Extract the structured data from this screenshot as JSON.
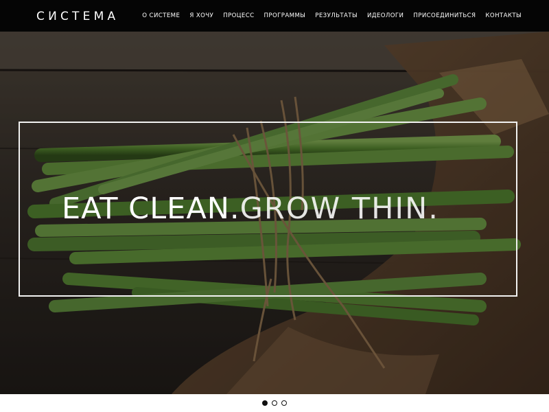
{
  "header": {
    "logo": "СИСТЕМА",
    "nav": [
      {
        "label": "О СИСТЕМЕ",
        "id": "about"
      },
      {
        "label": "Я ХОЧУ",
        "id": "i-want"
      },
      {
        "label": "ПРОЦЕСС",
        "id": "process"
      },
      {
        "label": "ПРОГРАММЫ",
        "id": "programs"
      },
      {
        "label": "РЕЗУЛЬТАТЫ",
        "id": "results"
      },
      {
        "label": "ИДЕОЛОГИ",
        "id": "ideologists"
      },
      {
        "label": "ПРИСОЕДИНИТЬСЯ",
        "id": "join"
      },
      {
        "label": "КОНТАКТЫ",
        "id": "contacts"
      }
    ]
  },
  "hero": {
    "tagline_bold": "EAT CLEAN.",
    "tagline_light": "GROW THIN.",
    "image": "asparagus-bundle-photo"
  },
  "slider": {
    "total": 3,
    "active": 1
  },
  "colors": {
    "header_bg": "#050505",
    "text": "#ffffff",
    "asparagus": "#5f8a3a"
  }
}
